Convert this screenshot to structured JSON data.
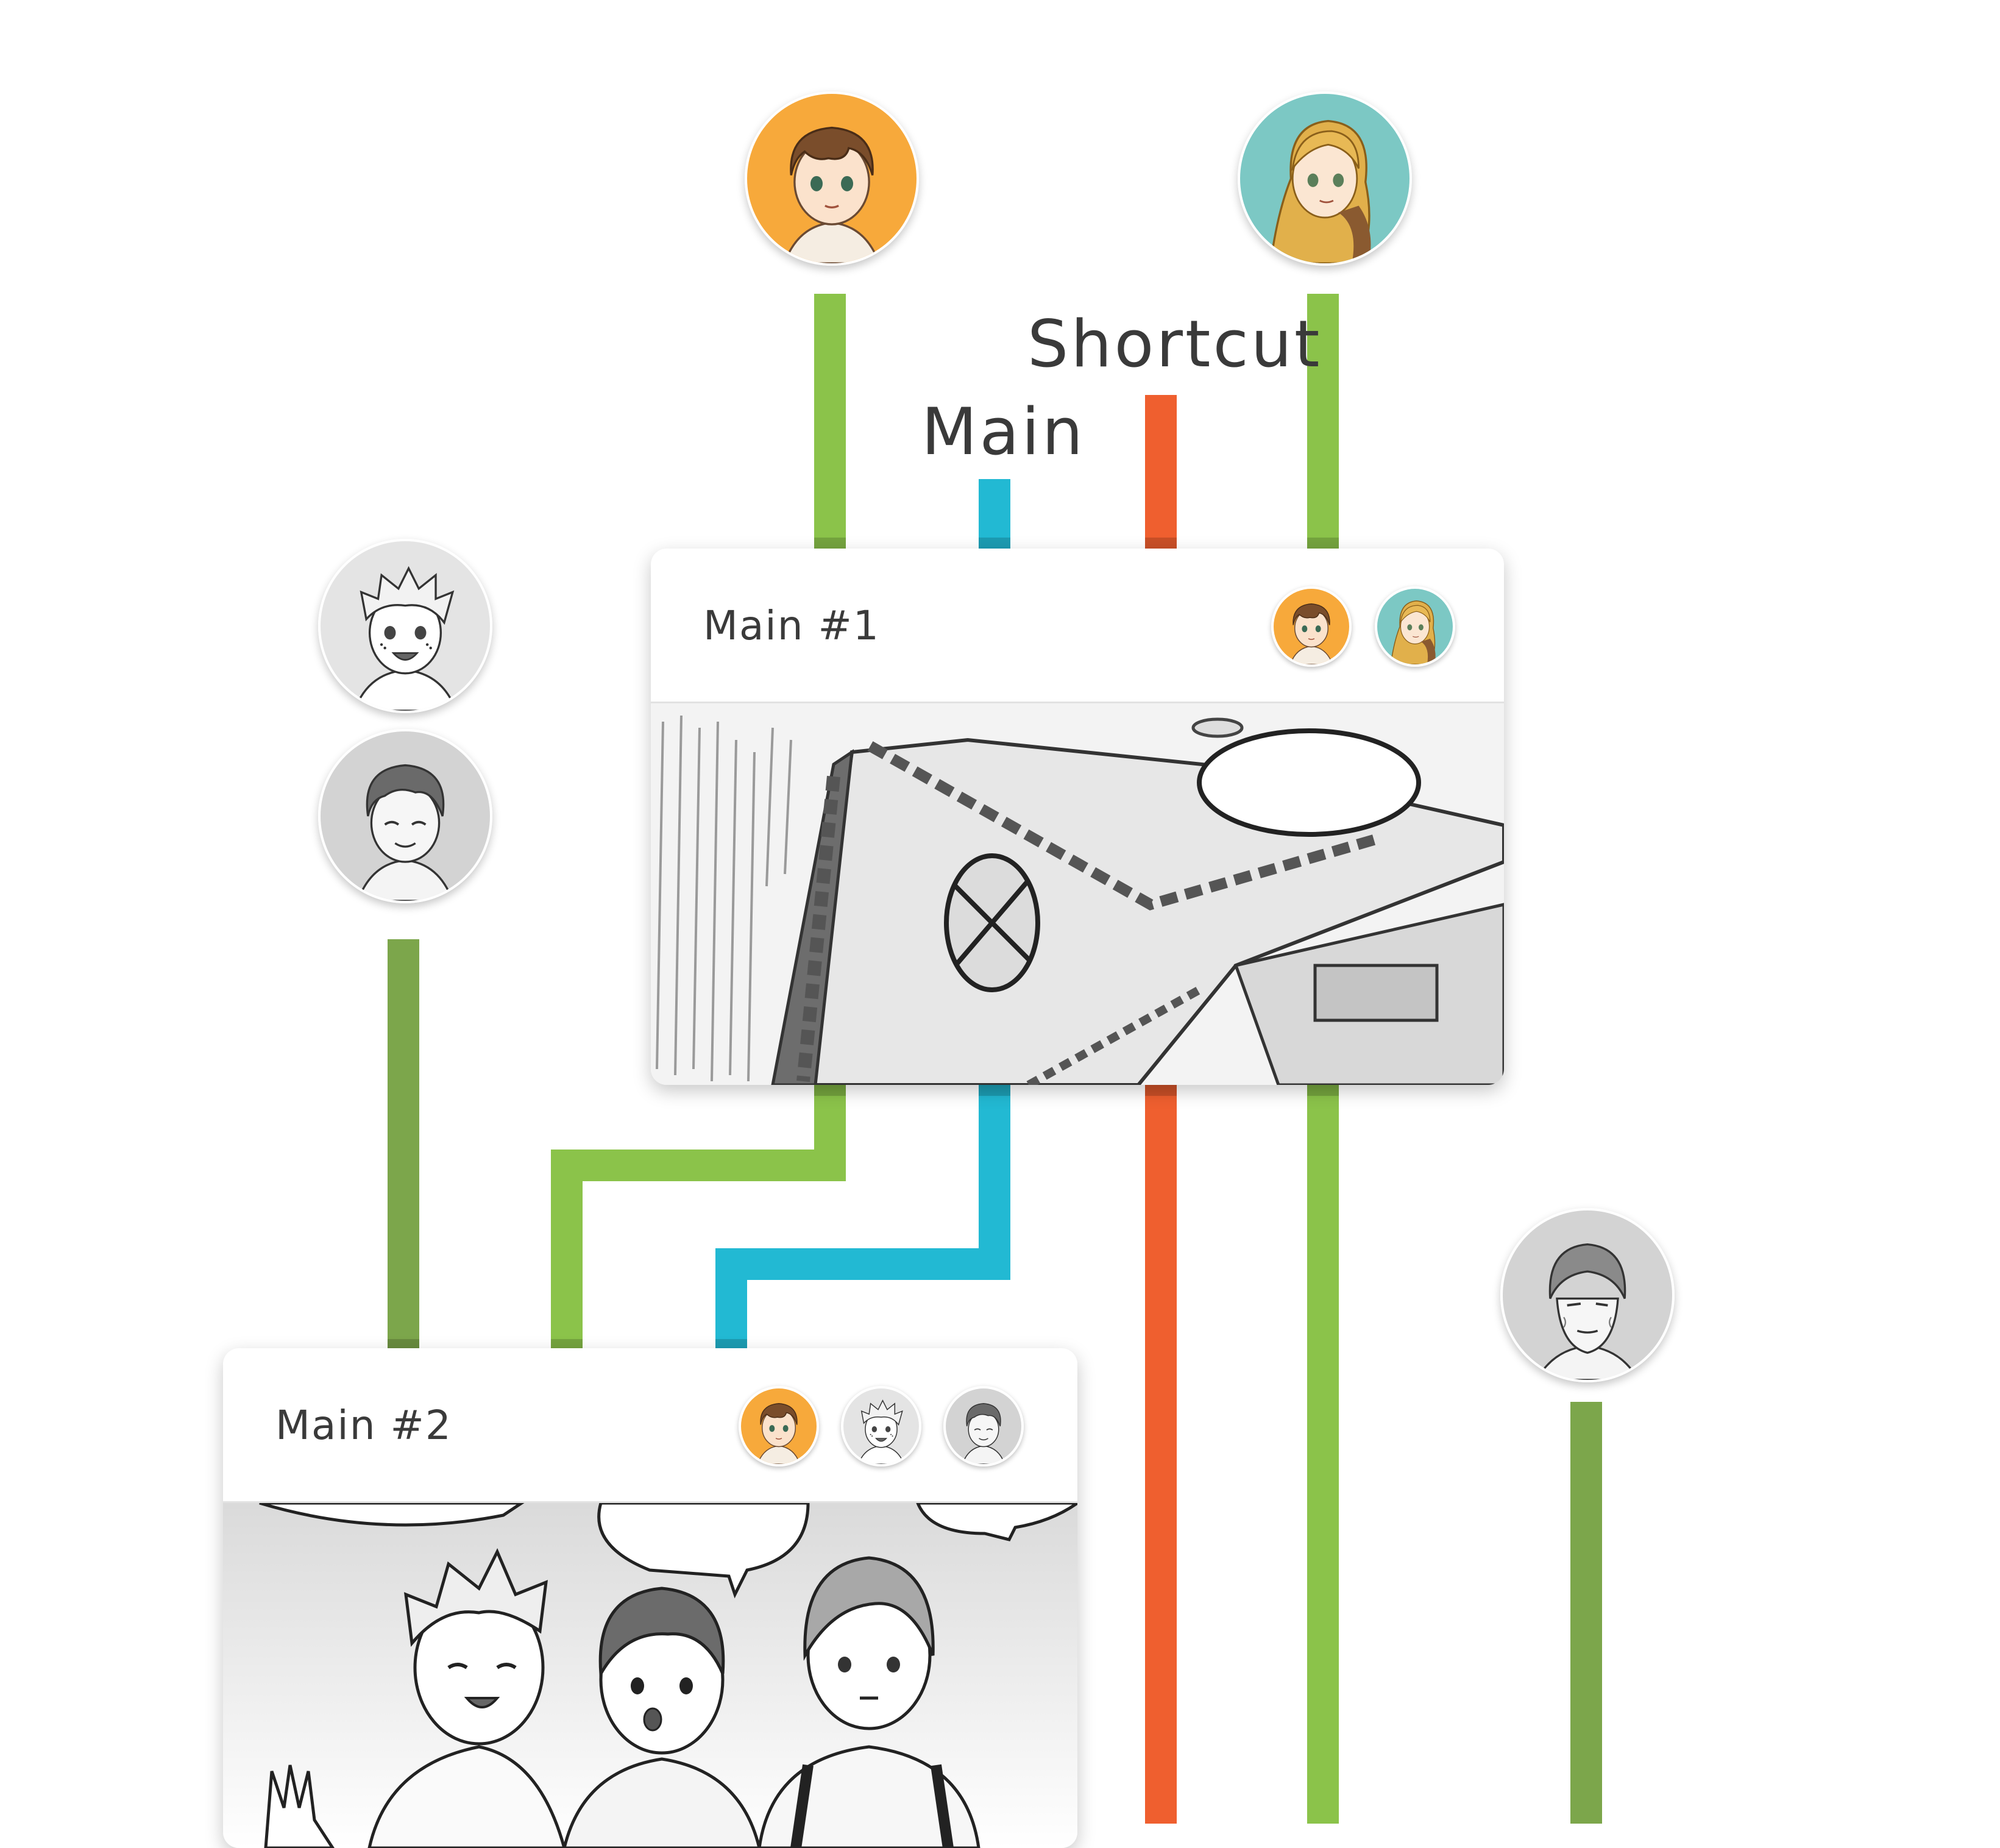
{
  "labels": {
    "shortcut": "Shortcut",
    "main": "Main"
  },
  "colors": {
    "green": "#8bc34a",
    "green_dark": "#7ca64b",
    "cyan": "#22b9d3",
    "orange": "#ef5f2f",
    "avatar_orange_bg": "#f7a93b",
    "avatar_teal_bg": "#7cc8c4",
    "avatar_gray_bg": "#d0d0d0"
  },
  "cards": [
    {
      "title": "Main #1",
      "participants": [
        "brown-hair-boy-avatar",
        "blonde-girl-avatar"
      ],
      "image": "sketch-storyboard-building"
    },
    {
      "title": "Main #2",
      "participants": [
        "brown-hair-boy-avatar",
        "freckled-boy-avatar",
        "dark-hair-boy-avatar"
      ],
      "image": "sketch-three-boys-talking"
    }
  ],
  "characters": [
    {
      "name": "brown-hair-boy-avatar",
      "style": "color",
      "bg": "orange"
    },
    {
      "name": "blonde-girl-avatar",
      "style": "color",
      "bg": "teal"
    },
    {
      "name": "freckled-boy-avatar",
      "style": "sketch",
      "bg": "gray"
    },
    {
      "name": "dark-hair-boy-avatar",
      "style": "sketch",
      "bg": "gray"
    },
    {
      "name": "older-man-avatar",
      "style": "sketch",
      "bg": "gray"
    }
  ]
}
